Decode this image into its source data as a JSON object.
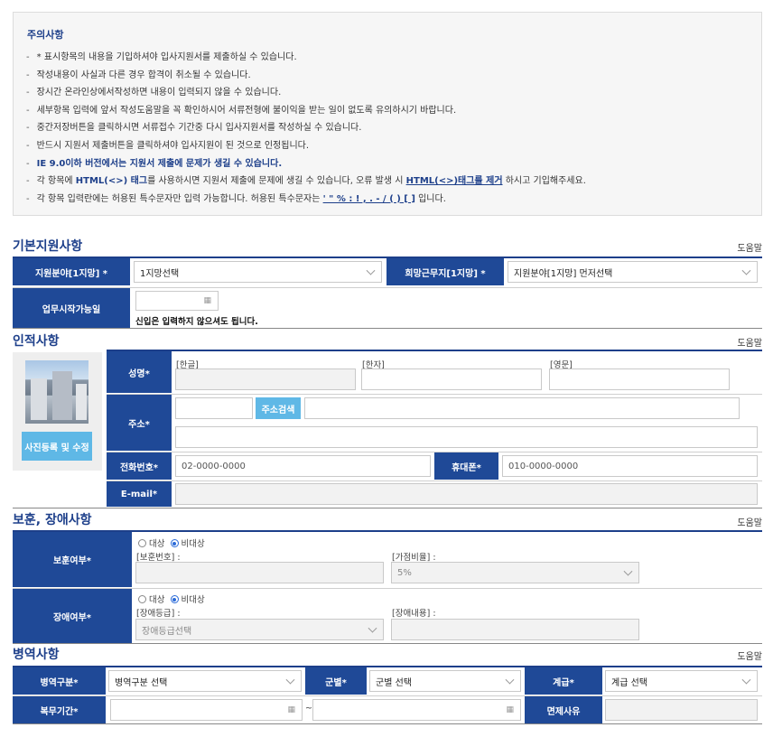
{
  "notice": {
    "title": "주의사항",
    "items": [
      "* 표시항목의 내용을 기입하셔야 입사지원서를 제출하실 수 있습니다.",
      "작성내용이 사실과 다른 경우 합격이 취소될 수 있습니다.",
      "장시간 온라인상에서작성하면 내용이 입력되지 않을 수 있습니다.",
      "세부항목 입력에 앞서 작성도움말을 꼭 확인하시어 서류전형에 불이익을 받는 일이 없도록 유의하시기 바랍니다.",
      "중간저장버튼을 클릭하시면 서류접수 기간중 다시 입사지원서를 작성하실 수 있습니다.",
      "반드시 지원서 제출버튼을 클릭하셔야 입사지원이 된 것으로 인정됩니다.",
      "IE 9.0이하 버전에서는 지원서 제출에 문제가 생길 수 있습니다."
    ],
    "html_line": {
      "a": "각 항목에 ",
      "b": "HTML(<>) 태그",
      "c": "를 사용하시면 지원서 제출에 문제에 생길 수 있습니다, 오류 발생 시 ",
      "d": "HTML(<>)태그를 제거",
      "e": " 하시고 기입해주세요."
    },
    "special_line": {
      "a": "각 항목 입력란에는 허용된 특수문자만 입력 가능합니다. 허용된 특수문자는 ",
      "b": "' \" % : ! , . - / ( ) [ ]",
      "c": " 입니다."
    }
  },
  "basic": {
    "title": "기본지원사항",
    "help": "도움말",
    "field_label": "지원분야[1지망] *",
    "field_value": "1지망선택",
    "location_label": "희망근무지[1지망] *",
    "location_value": "지원분야[1지망] 먼저선택",
    "start_label": "업무시작가능일",
    "start_note": "신입은 입력하지 않으셔도 됩니다."
  },
  "personal": {
    "title": "인적사항",
    "help": "도움말",
    "photo_button": "사진등록 및 수정",
    "name_label": "성명*",
    "name_korean": "[한글]",
    "name_hanja": "[한자]",
    "name_english": "[영문]",
    "address_label": "주소*",
    "address_search": "주소검색",
    "phone_label": "전화번호*",
    "phone_placeholder": "02-0000-0000",
    "mobile_label": "휴대폰*",
    "mobile_placeholder": "010-0000-0000",
    "email_label": "E-mail*"
  },
  "veteran": {
    "title": "보훈, 장애사항",
    "help": "도움말",
    "veteran_label": "보훈여부*",
    "opt_target": "대상",
    "opt_nontarget": "비대상",
    "veteran_no": "[보훈번호] :",
    "bonus_rate": "[가점비율] :",
    "bonus_value": "5%",
    "disability_label": "장애여부*",
    "disability_grade": "[장애등급] :",
    "disability_grade_value": "장애등급선택",
    "disability_detail": "[장애내용] :"
  },
  "military": {
    "title": "병역사항",
    "help": "도움말",
    "type_label": "병역구분*",
    "type_value": "병역구분 선택",
    "branch_label": "군별*",
    "branch_value": "군별 선택",
    "rank_label": "계급*",
    "rank_value": "계급 선택",
    "period_label": "복무기간*",
    "tilde": "~",
    "exempt_label": "면제사유"
  },
  "colors": {
    "label_bg": "#1f4997",
    "title": "#1d3f8a",
    "button": "#5fb8e6"
  },
  "icons": [
    "chevron-down-icon",
    "calendar-icon",
    "radio-icon"
  ]
}
